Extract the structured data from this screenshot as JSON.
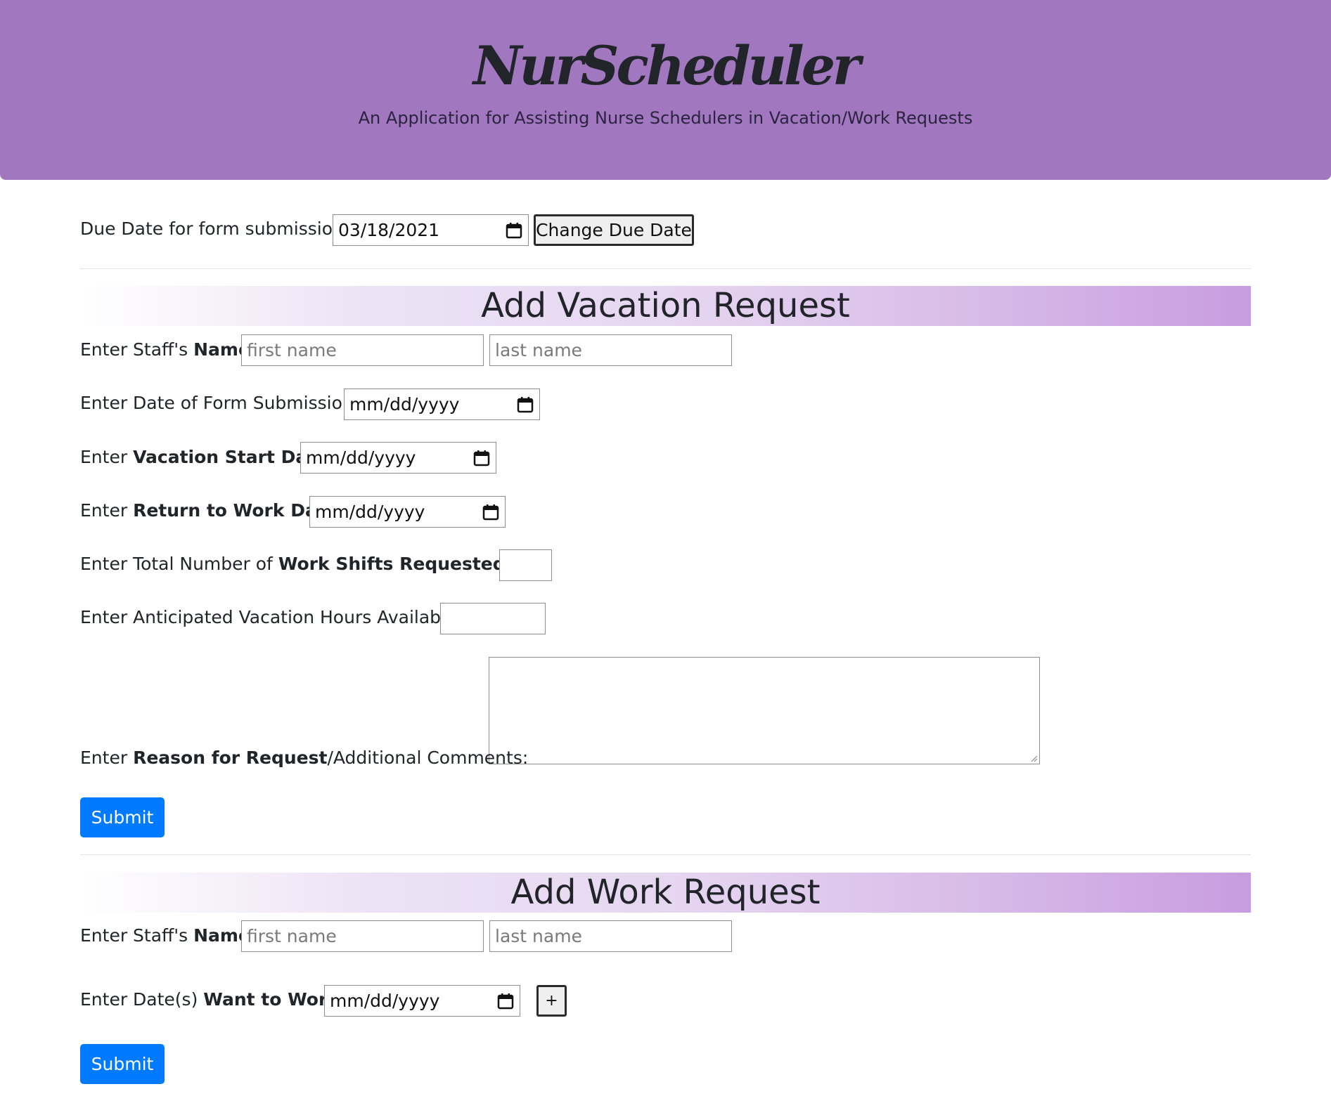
{
  "header": {
    "logo": "NurScheduler",
    "subtitle": "An Application for Assisting Nurse Schedulers in Vacation/Work Requests"
  },
  "due_date": {
    "label": "Due Date for form submission",
    "value": "03/18/2021",
    "button": "Change Due Date"
  },
  "vacation": {
    "title": "Add Vacation Request",
    "name_label_prefix": "Enter Staff's ",
    "name_label_bold": "Name",
    "name_label_suffix": ":",
    "first_placeholder": "first name",
    "last_placeholder": "last name",
    "submission_label": "Enter Date of Form Submission:",
    "submission_value": "mm/dd/yyyy",
    "start_prefix": "Enter ",
    "start_bold": "Vacation Start Date",
    "start_suffix": ":",
    "start_value": "mm/dd/yyyy",
    "return_prefix": "Enter ",
    "return_bold": "Return to Work Date",
    "return_suffix": ":",
    "return_value": "mm/dd/yyyy",
    "shifts_prefix": "Enter Total Number of ",
    "shifts_bold": "Work Shifts Requested Off",
    "shifts_suffix": ":",
    "hours_label": "Enter Anticipated Vacation Hours Available:",
    "reason_prefix": "Enter ",
    "reason_bold": "Reason for Request",
    "reason_suffix": "/Additional Comments:",
    "submit": "Submit"
  },
  "work": {
    "title": "Add Work Request",
    "name_label_prefix": "Enter Staff's ",
    "name_label_bold": "Name",
    "name_label_suffix": ":",
    "first_placeholder": "first name",
    "last_placeholder": "last name",
    "dates_prefix": "Enter Date(s) ",
    "dates_bold": "Want to Work",
    "dates_suffix": ":",
    "dates_value": "mm/dd/yyyy",
    "add_button": "+",
    "submit": "Submit"
  },
  "colors": {
    "header_bg": "#a178c0",
    "primary": "#007bff"
  }
}
